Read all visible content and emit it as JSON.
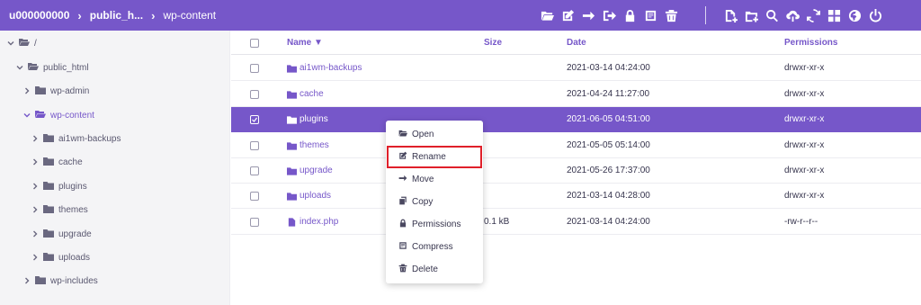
{
  "header": {
    "breadcrumbs": [
      "u000000000",
      "public_h...",
      "wp-content"
    ],
    "separator": "›",
    "toolbar": [
      "folder-open-icon",
      "edit-icon",
      "arrow-right-icon",
      "sign-out-icon",
      "lock-icon",
      "archive-icon",
      "trash-icon",
      "new-file-icon",
      "new-folder-icon",
      "search-icon",
      "upload-cloud-icon",
      "refresh-icon",
      "grid-icon",
      "globe-icon",
      "power-icon"
    ]
  },
  "sidebar": {
    "root": "/",
    "public_html": "public_html",
    "wp_admin": "wp-admin",
    "wp_content": "wp-content",
    "children": [
      "ai1wm-backups",
      "cache",
      "plugins",
      "themes",
      "upgrade",
      "uploads"
    ],
    "wp_includes": "wp-includes"
  },
  "filelist": {
    "columns": {
      "name": "Name ▼",
      "size": "Size",
      "date": "Date",
      "permissions": "Permissions"
    },
    "rows": [
      {
        "name": "ai1wm-backups",
        "size": "",
        "date": "2021-03-14 04:24:00",
        "perm": "drwxr-xr-x",
        "type": "folder"
      },
      {
        "name": "cache",
        "size": "",
        "date": "2021-04-24 11:27:00",
        "perm": "drwxr-xr-x",
        "type": "folder"
      },
      {
        "name": "plugins",
        "size": "",
        "date": "2021-06-05 04:51:00",
        "perm": "drwxr-xr-x",
        "type": "folder"
      },
      {
        "name": "themes",
        "size": "",
        "date": "2021-05-05 05:14:00",
        "perm": "drwxr-xr-x",
        "type": "folder"
      },
      {
        "name": "upgrade",
        "size": "",
        "date": "2021-05-26 17:37:00",
        "perm": "drwxr-xr-x",
        "type": "folder"
      },
      {
        "name": "uploads",
        "size": "",
        "date": "2021-03-14 04:28:00",
        "perm": "drwxr-xr-x",
        "type": "folder"
      },
      {
        "name": "index.php",
        "size": "0.1 kB",
        "date": "2021-03-14 04:24:00",
        "perm": "-rw-r--r--",
        "type": "file"
      }
    ],
    "selected_row": "plugins"
  },
  "context_menu": {
    "items": [
      {
        "label": "Open",
        "icon": "folder-open-icon"
      },
      {
        "label": "Rename",
        "icon": "edit-icon"
      },
      {
        "label": "Move",
        "icon": "arrow-right-icon"
      },
      {
        "label": "Copy",
        "icon": "copy-icon"
      },
      {
        "label": "Permissions",
        "icon": "lock-icon"
      },
      {
        "label": "Compress",
        "icon": "archive-icon"
      },
      {
        "label": "Delete",
        "icon": "trash-icon"
      }
    ],
    "highlighted": "Rename"
  },
  "colors": {
    "accent": "#7657c9",
    "highlight": "#e0202a",
    "sidebar_bg": "#f4f4f6"
  }
}
